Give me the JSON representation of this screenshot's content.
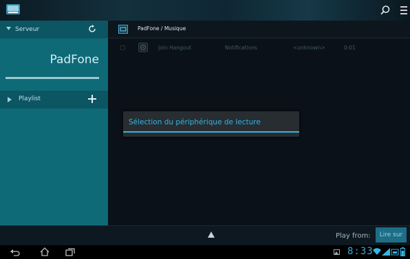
{
  "sidebar": {
    "server_label": "Serveur",
    "device_name": "PadFone",
    "playlist_label": "Playlist"
  },
  "main": {
    "breadcrumb": "PadFone / Musique",
    "rows": [
      {
        "title": "Join Hangout",
        "category": "Notifications",
        "artist": "<unknown>",
        "duration": "0:01"
      }
    ]
  },
  "dialog": {
    "title": "Sélection du périphérique de lecture"
  },
  "controlbar": {
    "play_from_label": "Play from:",
    "play_button_label": "Lire sur"
  },
  "systembar": {
    "time": "8:33"
  },
  "colors": {
    "accent": "#33b5e5",
    "sidebar": "#0f6a78",
    "button": "#1d6e86"
  }
}
